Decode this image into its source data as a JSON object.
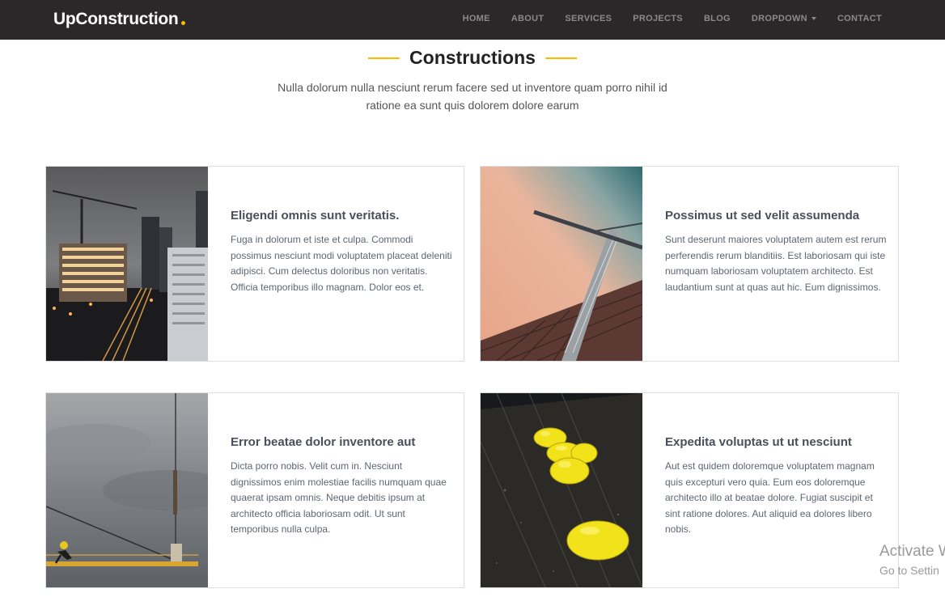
{
  "brand": {
    "name": "UpConstruction",
    "accent": "#feb900"
  },
  "nav": {
    "items": [
      "HOME",
      "ABOUT",
      "SERVICES",
      "PROJECTS",
      "BLOG",
      "DROPDOWN",
      "CONTACT"
    ]
  },
  "section": {
    "title": "Constructions",
    "subtitle": "Nulla dolorum nulla nesciunt rerum facere sed ut inventore quam porro nihil id ratione ea sunt quis dolorem dolore earum"
  },
  "cards": [
    {
      "title": "Eligendi omnis sunt veritatis.",
      "text": "Fuga in dolorum et iste et culpa. Commodi possimus nesciunt modi voluptatem placeat deleniti adipisci. Cum delectus doloribus non veritatis. Officia temporibus illo magnam. Dolor eos et.",
      "image": "city-crane-night-photo"
    },
    {
      "title": "Possimus ut sed velit assumenda",
      "text": "Sunt deserunt maiores voluptatem autem est rerum perferendis rerum blanditiis. Est laboriosam qui iste numquam laboriosam voluptatem architecto. Est laudantium sunt at quas aut hic. Eum dignissimos.",
      "image": "crane-sunset-photo"
    },
    {
      "title": "Error beatae dolor inventore aut",
      "text": "Dicta porro nobis. Velit cum in. Nesciunt dignissimos enim molestiae facilis numquam quae quaerat ipsam omnis. Neque debitis ipsum at architecto officia laboriosam odit. Ut sunt temporibus nulla culpa.",
      "image": "worker-on-beam-photo"
    },
    {
      "title": "Expedita voluptas ut ut nesciunt",
      "text": "Aut est quidem doloremque voluptatem magnam quis excepturi vero quia. Eum eos doloremque architecto illo at beatae dolore. Fugiat suscipit et sint ratione dolores. Aut aliquid ea dolores libero nobis.",
      "image": "yellow-hard-hats-photo"
    }
  ],
  "watermark": {
    "line1": "Activate W",
    "line2": "Go to Settin"
  }
}
